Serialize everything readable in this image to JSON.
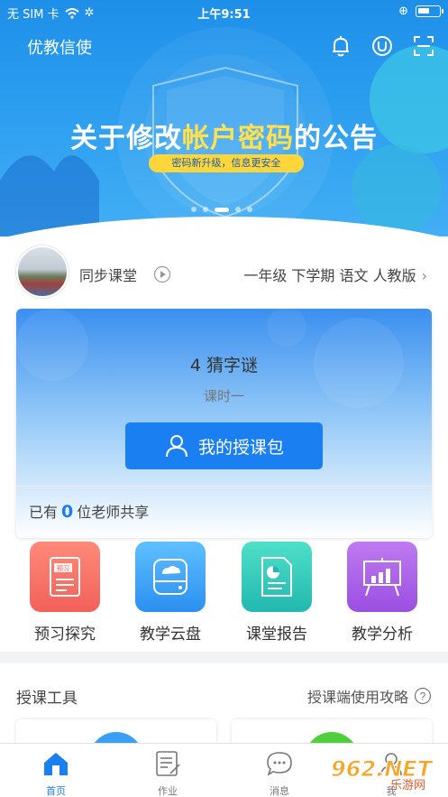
{
  "status_bar": {
    "carrier": "无 SIM 卡",
    "time": "上午9:51"
  },
  "header": {
    "app_title": "优教信使"
  },
  "banner": {
    "title_prefix": "关于修改",
    "title_highlight": "帐户密码",
    "title_suffix": "的公告",
    "subtitle": "密码新升级，信息更安全"
  },
  "course": {
    "name": "同步课堂",
    "grade_info": "一年级 下学期 语文 人教版"
  },
  "lesson": {
    "title": "4 猜字谜",
    "subtitle": "课时一",
    "package_button": "我的授课包",
    "share_prefix": "已有",
    "share_count": "0",
    "share_suffix": "位老师共享"
  },
  "features": [
    {
      "label": "预习探究",
      "icon_text": "预习"
    },
    {
      "label": "教学云盘"
    },
    {
      "label": "课堂报告"
    },
    {
      "label": "教学分析"
    }
  ],
  "tools": {
    "title": "授课工具",
    "guide": "授课端使用攻略"
  },
  "tabbar": [
    {
      "label": "首页",
      "active": true
    },
    {
      "label": "作业",
      "active": false
    },
    {
      "label": "消息",
      "active": false
    },
    {
      "label": "我",
      "active": false
    }
  ],
  "watermark": {
    "text": "962.NET",
    "sub": "乐游网"
  },
  "colors": {
    "primary": "#1a7ff0",
    "banner_yellow": "#ffe14d"
  }
}
